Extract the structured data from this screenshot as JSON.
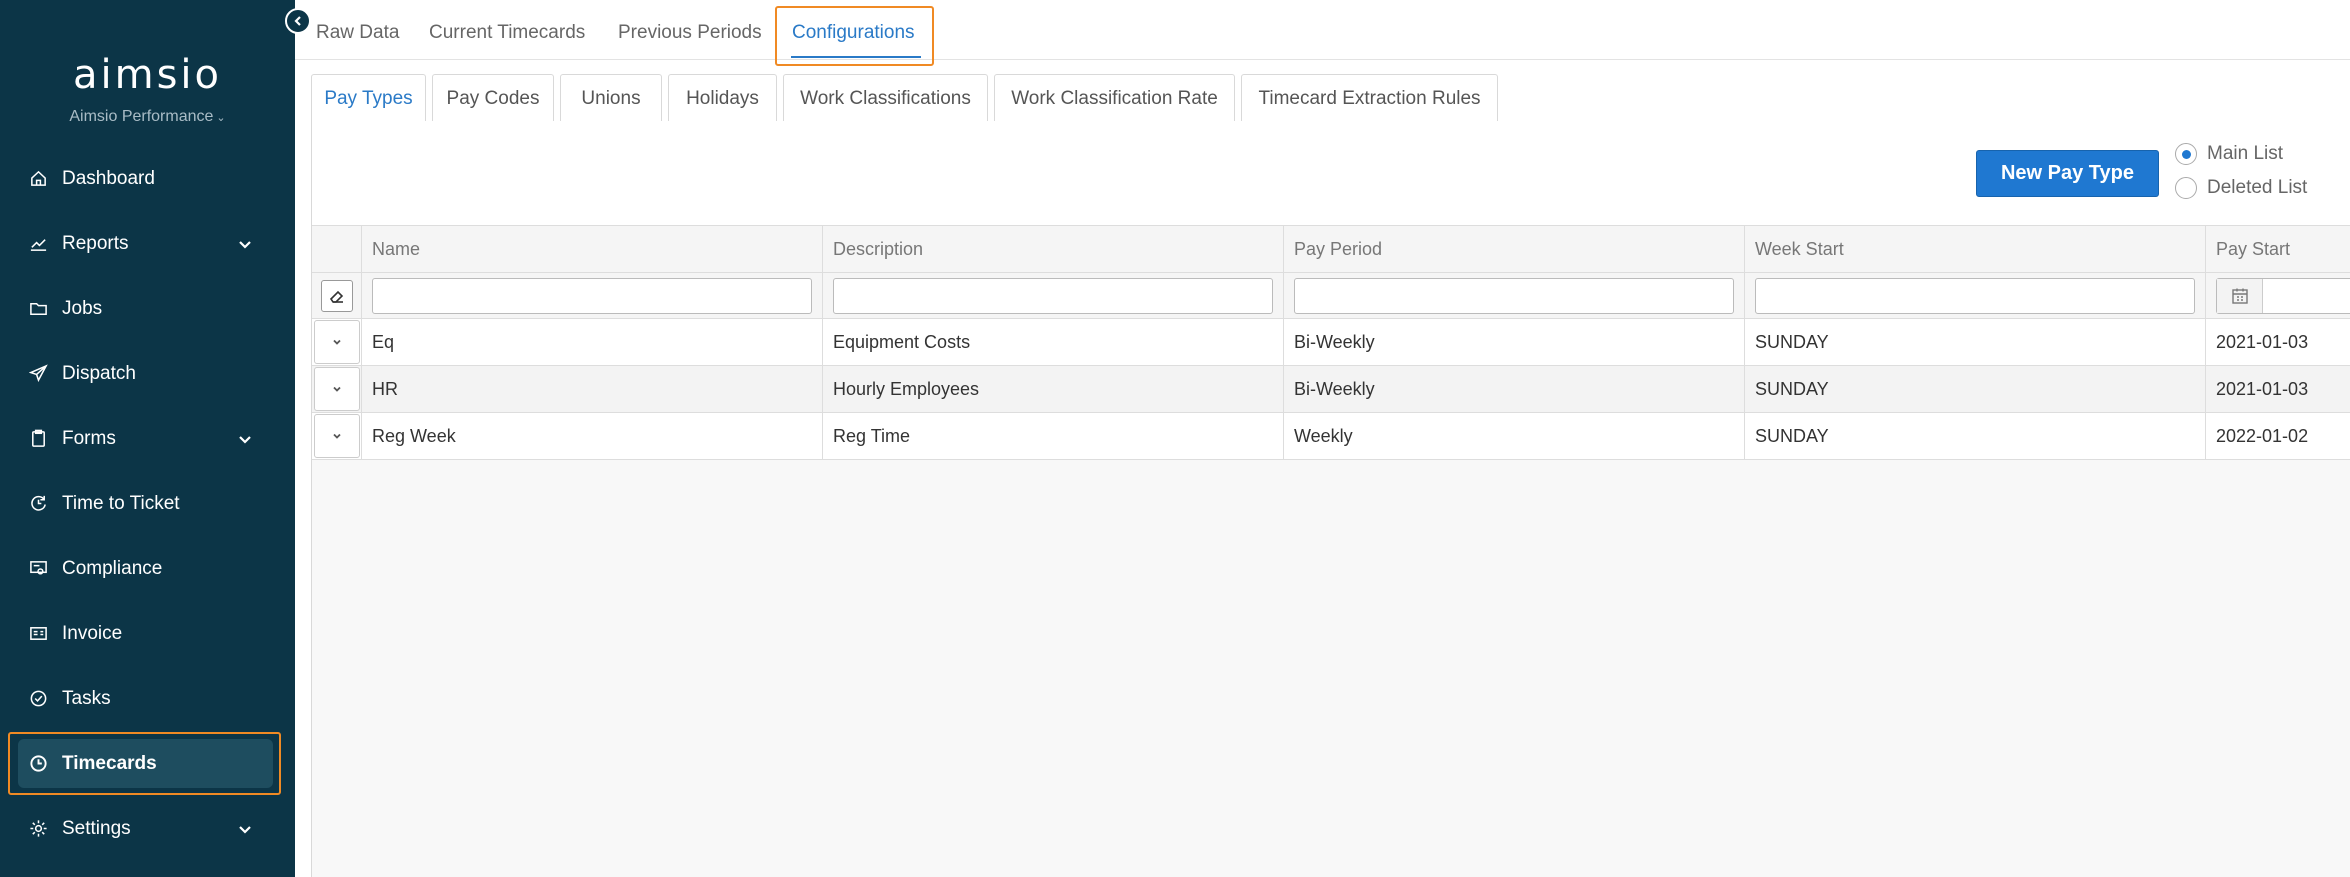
{
  "brand": {
    "logo": "aimsio",
    "subtitle": "Aimsio Performance"
  },
  "sidebar": {
    "items": [
      {
        "label": "Dashboard",
        "icon": "home-icon"
      },
      {
        "label": "Reports",
        "icon": "chart-icon",
        "expandable": true
      },
      {
        "label": "Jobs",
        "icon": "folder-icon"
      },
      {
        "label": "Dispatch",
        "icon": "send-icon"
      },
      {
        "label": "Forms",
        "icon": "clipboard-icon",
        "expandable": true
      },
      {
        "label": "Time to Ticket",
        "icon": "refresh-clock-icon"
      },
      {
        "label": "Compliance",
        "icon": "certificate-icon"
      },
      {
        "label": "Invoice",
        "icon": "invoice-icon"
      },
      {
        "label": "Tasks",
        "icon": "check-circle-icon"
      },
      {
        "label": "Timecards",
        "icon": "clock-icon",
        "active": true
      },
      {
        "label": "Settings",
        "icon": "gear-icon",
        "expandable": true
      }
    ]
  },
  "top_tabs": [
    {
      "label": "Raw Data"
    },
    {
      "label": "Current Timecards"
    },
    {
      "label": "Previous Periods"
    },
    {
      "label": "Configurations",
      "active": true
    }
  ],
  "sub_tabs": [
    {
      "label": "Pay Types",
      "active": true
    },
    {
      "label": "Pay Codes"
    },
    {
      "label": "Unions"
    },
    {
      "label": "Holidays"
    },
    {
      "label": "Work Classifications"
    },
    {
      "label": "Work Classification Rate"
    },
    {
      "label": "Timecard Extraction Rules"
    }
  ],
  "toolbar": {
    "new_button": "New Pay Type",
    "list_options": [
      {
        "label": "Main List",
        "selected": true
      },
      {
        "label": "Deleted List",
        "selected": false
      }
    ]
  },
  "table": {
    "columns": [
      "Name",
      "Description",
      "Pay Period",
      "Week Start",
      "Pay Start"
    ],
    "rows": [
      [
        "Eq",
        "Equipment Costs",
        "Bi-Weekly",
        "SUNDAY",
        "2021-01-03"
      ],
      [
        "HR",
        "Hourly Employees",
        "Bi-Weekly",
        "SUNDAY",
        "2021-01-03"
      ],
      [
        "Reg Week",
        "Reg Time",
        "Weekly",
        "SUNDAY",
        "2022-01-02"
      ]
    ]
  },
  "colors": {
    "sidebar_bg": "#0c3547",
    "accent": "#1f78d1",
    "highlight": "#f08a24",
    "active_tab": "#2a7ac7"
  }
}
